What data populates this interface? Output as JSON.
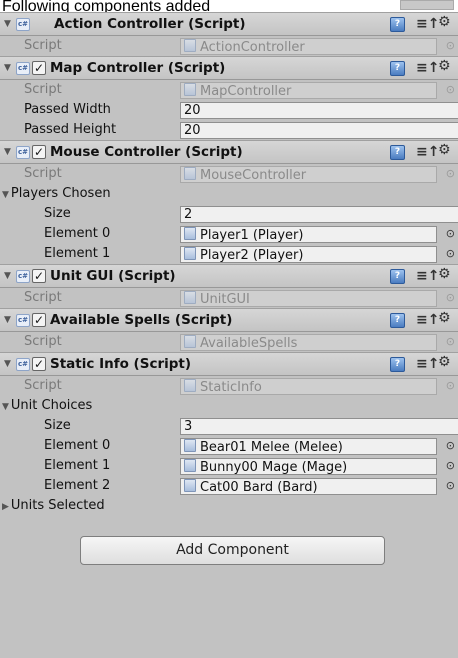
{
  "caption": "Following components added",
  "components": [
    {
      "title": "Action Controller (Script)",
      "checkbox": false,
      "rows": [
        {
          "label": "Script",
          "type": "objref",
          "value": "ActionController",
          "disabled": true
        }
      ]
    },
    {
      "title": "Map Controller (Script)",
      "checkbox": true,
      "rows": [
        {
          "label": "Script",
          "type": "objref",
          "value": "MapController",
          "disabled": true
        },
        {
          "label": "Passed Width",
          "type": "text",
          "value": "20"
        },
        {
          "label": "Passed Height",
          "type": "text",
          "value": "20"
        }
      ]
    },
    {
      "title": "Mouse Controller (Script)",
      "checkbox": true,
      "rows": [
        {
          "label": "Script",
          "type": "objref",
          "value": "MouseController",
          "disabled": true
        },
        {
          "label": "Players Chosen",
          "type": "foldout",
          "expanded": true
        },
        {
          "label": "Size",
          "type": "text",
          "value": "2",
          "indent": true
        },
        {
          "label": "Element 0",
          "type": "objref",
          "value": "Player1 (Player)",
          "indent": true
        },
        {
          "label": "Element 1",
          "type": "objref",
          "value": "Player2 (Player)",
          "indent": true
        }
      ]
    },
    {
      "title": "Unit GUI (Script)",
      "checkbox": true,
      "rows": [
        {
          "label": "Script",
          "type": "objref",
          "value": "UnitGUI",
          "disabled": true
        }
      ]
    },
    {
      "title": "Available Spells (Script)",
      "checkbox": true,
      "rows": [
        {
          "label": "Script",
          "type": "objref",
          "value": "AvailableSpells",
          "disabled": true
        }
      ]
    },
    {
      "title": "Static Info (Script)",
      "checkbox": true,
      "rows": [
        {
          "label": "Script",
          "type": "objref",
          "value": "StaticInfo",
          "disabled": true
        },
        {
          "label": "Unit Choices",
          "type": "foldout",
          "expanded": true
        },
        {
          "label": "Size",
          "type": "text",
          "value": "3",
          "indent": true
        },
        {
          "label": "Element 0",
          "type": "objref",
          "value": "Bear01 Melee (Melee)",
          "indent": true
        },
        {
          "label": "Element 1",
          "type": "objref",
          "value": "Bunny00 Mage (Mage)",
          "indent": true
        },
        {
          "label": "Element 2",
          "type": "objref",
          "value": "Cat00 Bard (Bard)",
          "indent": true
        },
        {
          "label": "Units Selected",
          "type": "foldout",
          "expanded": false
        }
      ]
    }
  ],
  "add_component_label": "Add Component",
  "colors": {
    "panel": "#c2c2c2",
    "header": "#cccccc",
    "field": "#f0f0f0"
  }
}
